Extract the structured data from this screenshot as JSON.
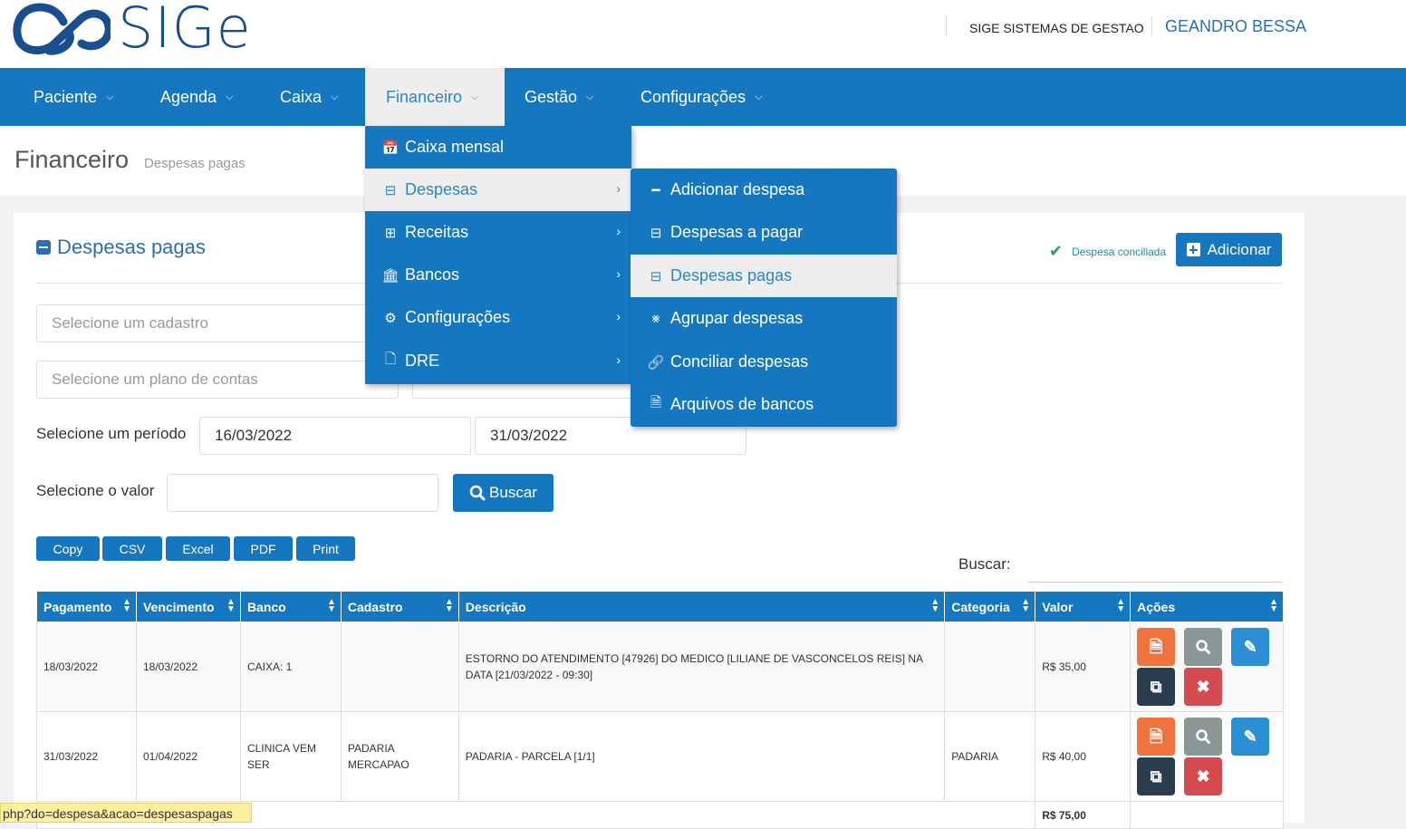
{
  "header": {
    "logo_text": "SIGe",
    "company": "SIGE SISTEMAS DE GESTAO",
    "user": "GEANDRO BESSA"
  },
  "nav": [
    {
      "label": "Paciente"
    },
    {
      "label": "Agenda"
    },
    {
      "label": "Caixa"
    },
    {
      "label": "Financeiro"
    },
    {
      "label": "Gestão"
    },
    {
      "label": "Configurações"
    }
  ],
  "page": {
    "title": "Financeiro",
    "subtitle": "Despesas pagas"
  },
  "panel": {
    "title": "Despesas pagas",
    "conciliada": "Despesa conciliada",
    "add_label": "Adicionar"
  },
  "filters": {
    "cadastro_placeholder": "Selecione um cadastro",
    "plano_placeholder": "Selecione um plano de contas",
    "periodo_label": "Selecione um período",
    "date_from": "16/03/2022",
    "date_to": "31/03/2022",
    "valor_label": "Selecione o valor",
    "buscar_label": "Buscar"
  },
  "export": [
    "Copy",
    "CSV",
    "Excel",
    "PDF",
    "Print"
  ],
  "search_label": "Buscar:",
  "table": {
    "headers": [
      "Pagamento",
      "Vencimento",
      "Banco",
      "Cadastro",
      "Descrição",
      "Categoria",
      "Valor",
      "Ações"
    ],
    "rows": [
      {
        "pagamento": "18/03/2022",
        "vencimento": "18/03/2022",
        "banco": "CAIXA: 1",
        "cadastro": "",
        "descricao": "ESTORNO DO ATENDIMENTO [47926] DO MEDICO [LILIANE DE VASCONCELOS REIS] NA DATA [21/03/2022 - 09:30]",
        "categoria": "",
        "valor": "R$ 35,00"
      },
      {
        "pagamento": "31/03/2022",
        "vencimento": "01/04/2022",
        "banco": "CLINICA VEM SER",
        "cadastro": "PADARIA MERCAPAO",
        "descricao": "PADARIA - PARCELA [1/1]",
        "categoria": "PADARIA",
        "valor": "R$ 40,00"
      }
    ],
    "total": "R$ 75,00"
  },
  "menu_financeiro": [
    {
      "label": "Caixa mensal",
      "icon": "calendar-icon"
    },
    {
      "label": "Despesas",
      "icon": "minus-square-icon"
    },
    {
      "label": "Receitas",
      "icon": "plus-square-icon"
    },
    {
      "label": "Bancos",
      "icon": "bank-icon"
    },
    {
      "label": "Configurações",
      "icon": "gears-icon"
    },
    {
      "label": "DRE",
      "icon": "file-icon"
    }
  ],
  "menu_despesas": [
    {
      "label": "Adicionar despesa",
      "icon": "minus-icon"
    },
    {
      "label": "Despesas a pagar",
      "icon": "minus-square-icon"
    },
    {
      "label": "Despesas pagas",
      "icon": "minus-square-icon"
    },
    {
      "label": "Agrupar despesas",
      "icon": "share-icon"
    },
    {
      "label": "Conciliar despesas",
      "icon": "link-icon"
    },
    {
      "label": "Arquivos de bancos",
      "icon": "excel-file-icon"
    }
  ],
  "status_url": "php?do=despesa&acao=despesaspagas",
  "colors": {
    "primary": "#1677c1",
    "highlight": "#eeeeee",
    "orange": "#f0733d",
    "red": "#d44c4f"
  }
}
